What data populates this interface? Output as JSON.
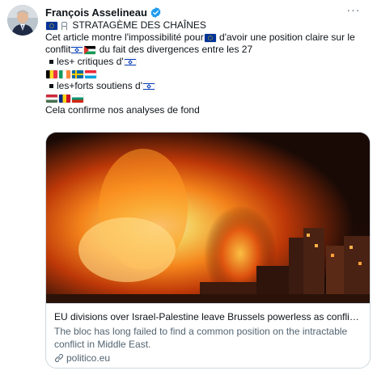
{
  "author": {
    "name": "François Asselineau"
  },
  "tweet": {
    "line1_text": " STRATAGÈME DES CHAÎNES",
    "line2_a": "Cet article montre l'impossibilité pour",
    "line2_b": " d'avoir une position claire sur le",
    "line3_a": "conflit",
    "line3_b": " du fait des divergences entre les 27",
    "line4_text": "les+ critiques d'",
    "line6_text": "les+forts soutiens d'",
    "line8_text": "Cela confirme nos analyses de fond"
  },
  "card": {
    "title": "EU divisions over Israel-Palestine leave Brussels powerless as conflict w...",
    "description": "The bloc has long failed to find a common position on the intractable conflict in Middle East.",
    "domain": "politico.eu"
  },
  "icons": {
    "verified": "verified-badge-icon",
    "more": "more-options-icon",
    "link": "link-icon"
  },
  "colors": {
    "accent": "#1d9bf0",
    "secondary_text": "#536471",
    "border": "#cfd9de"
  }
}
